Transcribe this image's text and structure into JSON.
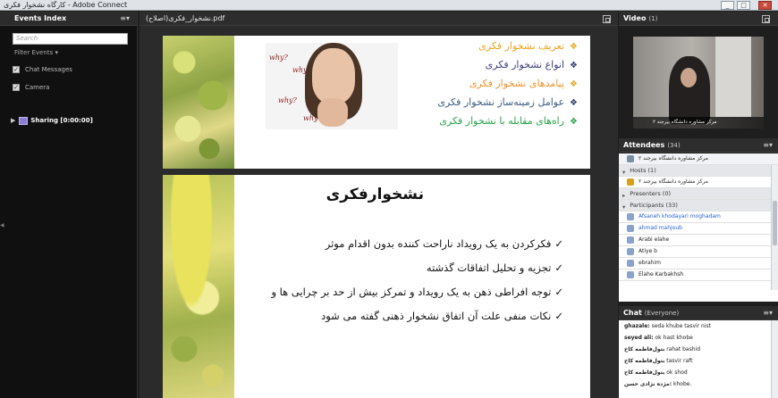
{
  "window": {
    "title": "کارگاه نشخوار فکری - Adobe Connect",
    "controls": [
      "_",
      "□",
      "✕"
    ]
  },
  "events_panel": {
    "title": "Events Index",
    "search_placeholder": "Search",
    "filter_label": "Filter Events",
    "checks": [
      {
        "label": "Chat Messages",
        "checked": true
      },
      {
        "label": "Camera",
        "checked": true
      }
    ],
    "sharing_item": "Sharing [0:00:00]"
  },
  "share_pod": {
    "file_name": "نشخوار_فکری(اصلاح).pdf",
    "slide1": {
      "bullets": [
        {
          "text": "تعریف نشخوار فکری",
          "color": "#f0a21b"
        },
        {
          "text": "انواع نشخوار فکری",
          "color": "#3b3f7a"
        },
        {
          "text": "پیامدهای نشخوار فکری",
          "color": "#f0932b"
        },
        {
          "text": "عوامل زمینه‌ساز نشخوار فکری",
          "color": "#3a5d82"
        },
        {
          "text": "راه‌های مقابله با نشخوار فکری",
          "color": "#2aa44a"
        }
      ],
      "why_words": [
        "why?",
        "why?",
        "why?",
        "why?"
      ]
    },
    "slide2": {
      "title": "نشخوارفکری",
      "items": [
        "فکرکردن به یک رویداد ناراحت کننده بدون اقدام موثر",
        "تجزیه و تحلیل اتفاقات گذشته",
        "توجه افراطی ذهن به یک رویداد و تمرکز بیش از حد بر چرایی ها و",
        "نکات منفی علت آن اتفاق نشخوار ذهنی گفته می شود"
      ],
      "check_glyph": "✓"
    }
  },
  "video_pod": {
    "title": "Video",
    "count": "(1)",
    "caption": "مرکز مشاوره دانشگاه بیرجند ۲"
  },
  "attendees_pod": {
    "title": "Attendees",
    "count": "(34)",
    "me": "مرکز مشاوره دانشگاه بیرجند ۲",
    "hosts_label": "Hosts (1)",
    "host_name": "مرکز مشاوره دانشگاه بیرجند ۲",
    "presenters_label": "Presenters (0)",
    "participants_label": "Participants (33)",
    "participants": [
      {
        "name": "Afsaneh khodayari moghadam",
        "link": true
      },
      {
        "name": "ahmad mahjoub",
        "link": true
      },
      {
        "name": "Arabi elahe",
        "link": false
      },
      {
        "name": "Atiye b",
        "link": false
      },
      {
        "name": "ebrahim",
        "link": false
      },
      {
        "name": "Elahe Karbakhsh",
        "link": false
      }
    ]
  },
  "chat_pod": {
    "title": "Chat",
    "scope": "(Everyone)",
    "messages": [
      {
        "sender": "ghazale:",
        "text": " seda khube tasvir nist"
      },
      {
        "sender": "seyed ali:",
        "text": " ok hast khobe"
      },
      {
        "sender": "بتول‌فاطمه کاخ",
        "text": " rahat bashid"
      },
      {
        "sender": "بتول‌فاطمه کاخ",
        "text": " tasvir raft"
      },
      {
        "sender": "بتول‌فاطمه کاخ",
        "text": " ok shod"
      },
      {
        "sender": "مژده نژادی حسن:",
        "text": " khobe."
      }
    ]
  }
}
